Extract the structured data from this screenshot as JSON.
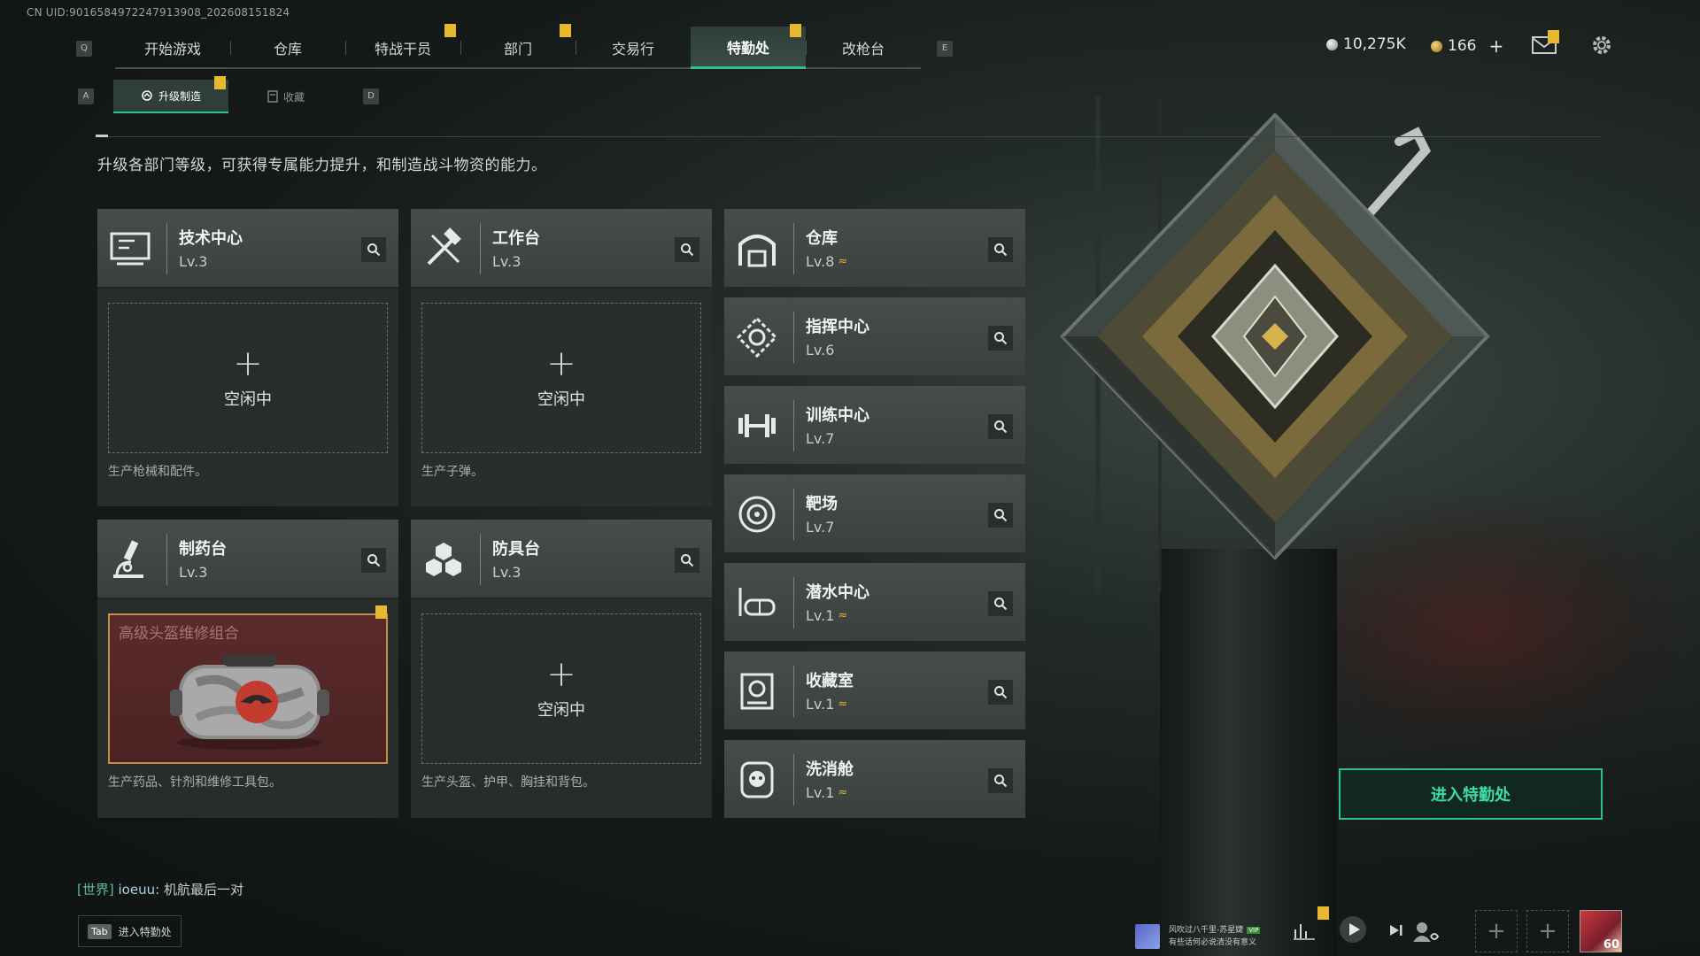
{
  "uid_text": "CN UID:9016584972247913908_202608151824",
  "nav": {
    "key_left": "Q",
    "key_right": "E",
    "tabs": [
      {
        "label": "开始游戏",
        "alert": false
      },
      {
        "label": "仓库",
        "alert": true
      },
      {
        "label": "特战干员",
        "alert": false
      },
      {
        "label": "部门",
        "alert": true
      },
      {
        "label": "交易行",
        "alert": true
      },
      {
        "label": "特勤处",
        "alert": false,
        "active": true
      },
      {
        "label": "改枪台",
        "alert": false
      }
    ],
    "alert_glyph": "!"
  },
  "currency": {
    "silver": "10,275K",
    "gold": "166",
    "gold_add": "+",
    "silver_color": "#c8c8c8",
    "gold_color": "#d1a53a"
  },
  "subnav": {
    "key_left": "A",
    "key_right": "D",
    "tabs": [
      {
        "label": "升级制造",
        "icon": "upgrade-icon",
        "active": true
      },
      {
        "label": "收藏",
        "icon": "collection-icon",
        "active": false
      }
    ]
  },
  "description": "升级各部门等级，可获得专属能力提升，和制造战斗物资的能力。",
  "crafting_facilities": [
    {
      "name": "技术中心",
      "level": "Lv.3",
      "icon": "monitor-icon",
      "status": "空闲中",
      "plus": "+",
      "desc": "生产枪械和配件。"
    },
    {
      "name": "工作台",
      "level": "Lv.3",
      "icon": "tools-icon",
      "status": "空闲中",
      "plus": "+",
      "desc": "生产子弹。"
    },
    {
      "name": "制药台",
      "level": "Lv.3",
      "icon": "microscope-icon",
      "crafting_item": "高级头盔维修组合",
      "desc": "生产药品、针剂和维修工具包。"
    },
    {
      "name": "防具台",
      "level": "Lv.3",
      "icon": "cubes-icon",
      "status": "空闲中",
      "plus": "+",
      "desc": "生产头盔、护甲、胸挂和背包。"
    }
  ],
  "department_facilities": [
    {
      "name": "仓库",
      "level": "Lv.8",
      "upgradable": true,
      "icon": "warehouse-icon"
    },
    {
      "name": "指挥中心",
      "level": "Lv.6",
      "upgradable": false,
      "icon": "command-icon"
    },
    {
      "name": "训练中心",
      "level": "Lv.7",
      "upgradable": false,
      "icon": "dumbbell-icon"
    },
    {
      "name": "靶场",
      "level": "Lv.7",
      "upgradable": false,
      "icon": "target-icon"
    },
    {
      "name": "潜水中心",
      "level": "Lv.1",
      "upgradable": true,
      "icon": "diving-icon"
    },
    {
      "name": "收藏室",
      "level": "Lv.1",
      "upgradable": true,
      "icon": "trophy-icon"
    },
    {
      "name": "洗消舱",
      "level": "Lv.1",
      "upgradable": true,
      "icon": "decon-icon"
    }
  ],
  "upgrade_glyph": "≈",
  "enter_button": "进入特勤处",
  "chat": {
    "channel": "[世界]",
    "user": "ioeuu",
    "separator": ":",
    "message": "机航最后一对"
  },
  "tab_hint": {
    "key": "Tab",
    "label": "进入特勤处"
  },
  "music": {
    "line1": "风吹过八千里-苏星婕",
    "vip": "VIP",
    "line2": "有些话何必说清没有意义"
  },
  "player": {
    "level": "60"
  },
  "add_glyph": "+",
  "accent_color": "#2fbf93",
  "alert_color": "#e7b92f"
}
